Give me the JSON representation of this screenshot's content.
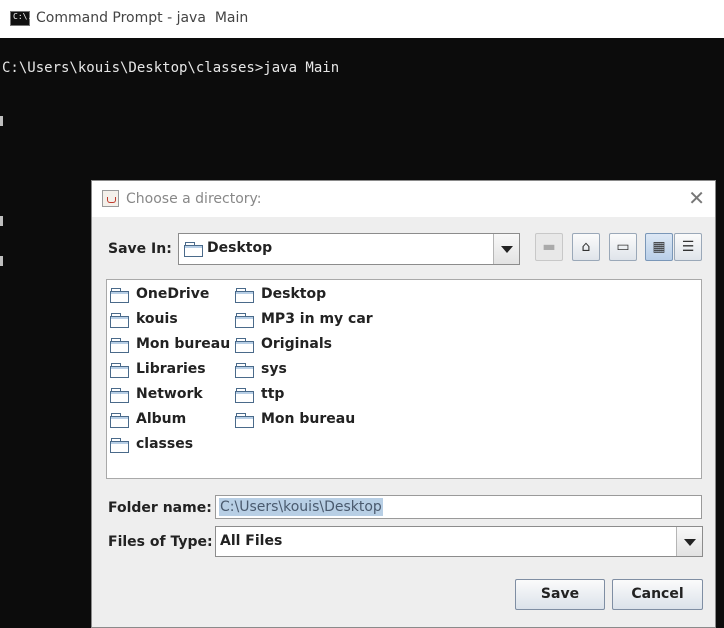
{
  "console": {
    "window_title": "Command Prompt - java  Main",
    "icon_label": "C:\\.",
    "command_line": "C:\\Users\\kouis\\Desktop\\classes>java Main"
  },
  "dialog": {
    "title": "Choose a directory:",
    "close_glyph": "✕",
    "save_in_label": "Save In:",
    "save_in_value": "Desktop",
    "toolbar": {
      "up_glyph": "▬",
      "home_glyph": "⌂",
      "new_folder_glyph": "▭",
      "list_view_glyph": "▦",
      "details_view_glyph": "☰"
    },
    "files_col1": [
      "OneDrive",
      "kouis",
      "Mon bureau",
      "Libraries",
      "Network",
      "Album",
      "classes"
    ],
    "files_col2": [
      "Desktop",
      "MP3 in my car",
      "Originals",
      "sys",
      "ttp",
      "Mon bureau"
    ],
    "folder_name_label": "Folder name:",
    "folder_name_value": "C:\\Users\\kouis\\Desktop",
    "files_of_type_label": "Files of Type:",
    "files_of_type_value": "All Files",
    "save_button": "Save",
    "cancel_button": "Cancel"
  }
}
